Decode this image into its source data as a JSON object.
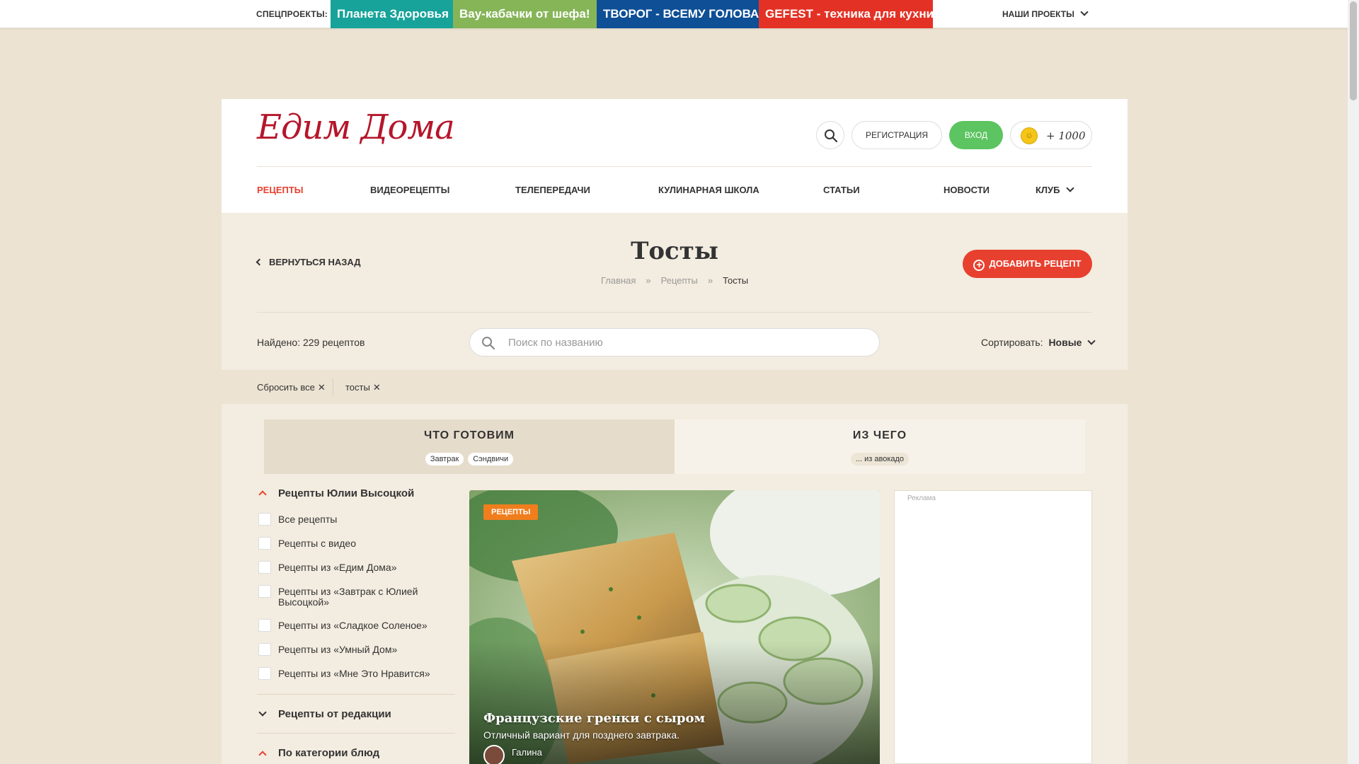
{
  "topbar": {
    "label": "СПЕЦПРОЕКТЫ:",
    "projects": [
      {
        "label": "Планета Здоровья",
        "color": "#17a39a"
      },
      {
        "label": "Вау-кабачки от шефа!",
        "color": "#86b558"
      },
      {
        "label": "ТВОРОГ - ВСЕМУ ГОЛОВА!",
        "color": "#0e4f96"
      },
      {
        "label": "GEFEST - техника для кухни",
        "color": "#e33225"
      }
    ],
    "our_projects": "НАШИ ПРОЕКТЫ"
  },
  "header": {
    "logo": "Едим Дома",
    "register": "РЕГИСТРАЦИЯ",
    "login": "ВХОД",
    "coins": "+ 1000",
    "nav": [
      {
        "label": "РЕЦЕПТЫ",
        "active": true
      },
      {
        "label": "ВИДЕОРЕЦЕПТЫ"
      },
      {
        "label": "ТЕЛЕПЕРЕДАЧИ"
      },
      {
        "label": "КУЛИНАРНАЯ ШКОЛА"
      },
      {
        "label": "СТАТЬИ"
      },
      {
        "label": "НОВОСТИ"
      },
      {
        "label": "КЛУБ"
      }
    ]
  },
  "page": {
    "back": "ВЕРНУТЬСЯ НАЗАД",
    "title": "Тосты",
    "breadcrumbs": [
      "Главная",
      "Рецепты",
      "Тосты"
    ],
    "breadcrumb_sep": "»",
    "add_recipe": "ДОБАВИТЬ РЕЦЕПТ",
    "found": "Найдено: 229 рецептов",
    "search_placeholder": "Поиск по названию",
    "sort_label": "Сортировать:",
    "sort_value": "Новые"
  },
  "filters": {
    "reset": "Сбросить все",
    "active": [
      "тосты"
    ]
  },
  "tabs": [
    {
      "title": "ЧТО ГОТОВИМ",
      "tags": [
        "Завтрак",
        "Сэндвичи"
      ]
    },
    {
      "title": "ИЗ ЧЕГО",
      "tags": [
        "... из авокадо"
      ]
    }
  ],
  "sidebar": {
    "section1": "Рецепты Юлии Высоцкой",
    "options": [
      "Все рецепты",
      "Рецепты с видео",
      "Рецепты из «Едим Дома»",
      "Рецепты из «Завтрак с Юлией Высоцкой»",
      "Рецепты из «Сладкое Соленое»",
      "Рецепты из «Умный Дом»",
      "Рецепты из «Мне Это Нравится»"
    ],
    "section2": "Рецепты от редакции",
    "section3": "По категории блюд"
  },
  "card": {
    "label": "РЕЦЕПТЫ",
    "title": "Французские гренки с сыром",
    "description": "Отличный вариант для позднего завтрака.",
    "author": "Галина"
  },
  "ad": {
    "label": "Реклама"
  },
  "colors": {
    "accent": "#e8402f",
    "login": "#5cc460",
    "brand": "#b5162b"
  }
}
